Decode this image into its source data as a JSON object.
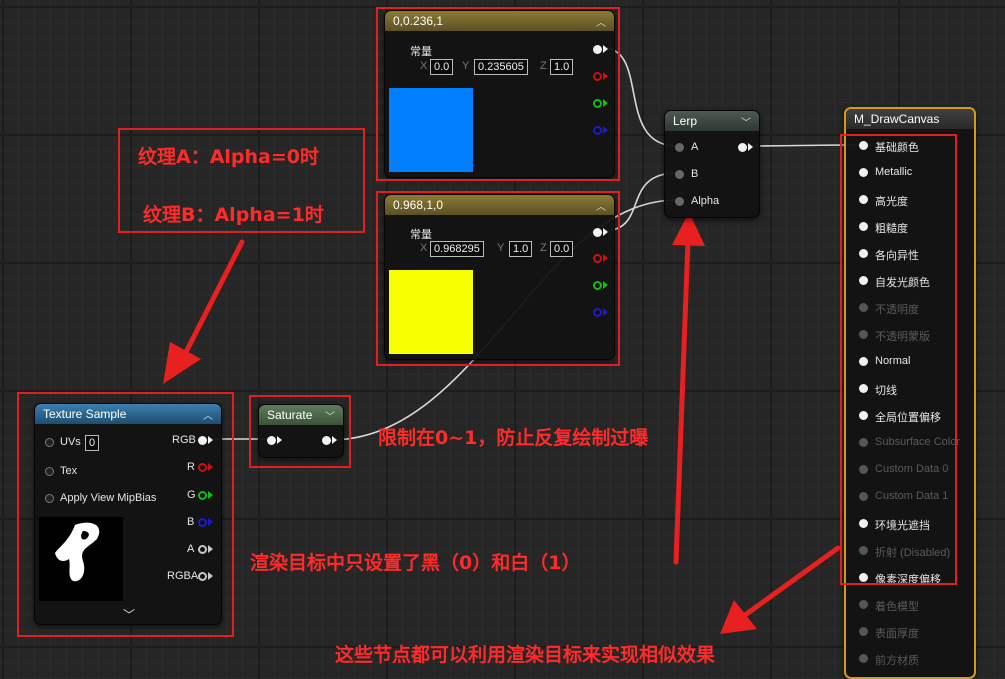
{
  "const1": {
    "title": "0,0.236,1",
    "label": "常量",
    "x_axis": "X",
    "x_value": "0.0",
    "y_axis": "Y",
    "y_value": "0.235605",
    "z_axis": "Z",
    "z_value": "1.0",
    "swatch_color": "#0080ff"
  },
  "const2": {
    "title": "0.968,1,0",
    "label": "常量",
    "x_axis": "X",
    "x_value": "0.968295",
    "y_axis": "Y",
    "y_value": "1.0",
    "z_axis": "Z",
    "z_value": "0.0",
    "swatch_color": "#f8ff00"
  },
  "lerp": {
    "title": "Lerp",
    "input_a": "A",
    "input_b": "B",
    "input_alpha": "Alpha"
  },
  "texture_sample": {
    "title": "Texture Sample",
    "uvs_label": "UVs",
    "uvs_value": "0",
    "tex_label": "Tex",
    "mip_label": "Apply View MipBias",
    "outputs": [
      "RGB",
      "R",
      "G",
      "B",
      "A",
      "RGBA"
    ]
  },
  "saturate": {
    "title": "Saturate"
  },
  "material": {
    "title": "M_DrawCanvas",
    "pins": [
      {
        "label": "基础颜色",
        "enabled": true
      },
      {
        "label": "Metallic",
        "enabled": true
      },
      {
        "label": "高光度",
        "enabled": true
      },
      {
        "label": "粗糙度",
        "enabled": true
      },
      {
        "label": "各向异性",
        "enabled": true
      },
      {
        "label": "自发光颜色",
        "enabled": true
      },
      {
        "label": "不透明度",
        "enabled": false
      },
      {
        "label": "不透明蒙版",
        "enabled": false
      },
      {
        "label": "Normal",
        "enabled": true
      },
      {
        "label": "切线",
        "enabled": true
      },
      {
        "label": "全局位置偏移",
        "enabled": true
      },
      {
        "label": "Subsurface Color",
        "enabled": false
      },
      {
        "label": "Custom Data 0",
        "enabled": false
      },
      {
        "label": "Custom Data 1",
        "enabled": false
      },
      {
        "label": "环境光遮挡",
        "enabled": true
      },
      {
        "label": "折射 (Disabled)",
        "enabled": false
      },
      {
        "label": "像素深度偏移",
        "enabled": true
      },
      {
        "label": "着色模型",
        "enabled": false
      },
      {
        "label": "表面厚度",
        "enabled": false
      },
      {
        "label": "前方材质",
        "enabled": false
      }
    ]
  },
  "annotations": {
    "texture_a": "纹理A：Alpha=0时",
    "texture_b": "纹理B：Alpha=1时",
    "clamp_note": "限制在0~1，防止反复绘制过曝",
    "render_target_note": "渲染目标中只设置了黑（0）和白（1）",
    "nodes_note": "这些节点都可以利用渲染目标来实现相似效果"
  },
  "colors": {
    "annotation_red": "#e02020",
    "material_border": "#d49a1c"
  }
}
